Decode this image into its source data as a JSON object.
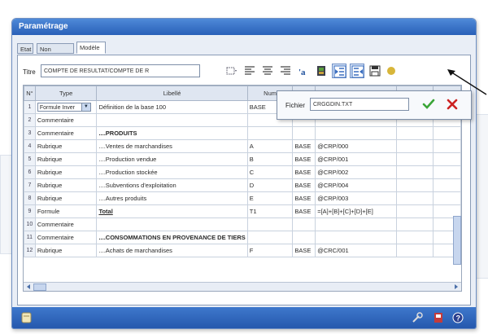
{
  "window": {
    "title": "Paramétrage"
  },
  "tabs": [
    {
      "label": "Etat",
      "active": false
    },
    {
      "label": "Non affectés",
      "active": false
    },
    {
      "label": "Modèle",
      "active": true
    }
  ],
  "toolbar": {
    "titre_label": "Titre",
    "titre_value": "COMPTE DE RESULTAT/COMPTE DE R",
    "icons": [
      "grid-menu-icon",
      "align-left-icon",
      "align-center-icon",
      "align-right-icon",
      "font-size-icon",
      "color-book-icon",
      "indent-in-icon",
      "indent-out-icon",
      "save-icon",
      "apply-icon"
    ]
  },
  "grid": {
    "columns": [
      "N°",
      "Type",
      "Libellé",
      "Num",
      "",
      "",
      ""
    ],
    "rows": [
      {
        "n": "1",
        "type": "Formule Inver",
        "combo": true,
        "libelle": "Définition de la base 100",
        "style": "",
        "num": "BASE",
        "base": "",
        "formula": ""
      },
      {
        "n": "2",
        "type": "Commentaire",
        "combo": false,
        "libelle": "",
        "style": "",
        "num": "",
        "base": "",
        "formula": ""
      },
      {
        "n": "3",
        "type": "Commentaire",
        "combo": false,
        "libelle": "....PRODUITS",
        "style": "bold",
        "num": "",
        "base": "",
        "formula": ""
      },
      {
        "n": "4",
        "type": "Rubrique",
        "combo": false,
        "libelle": "....Ventes de marchandises",
        "style": "",
        "num": "A",
        "base": "BASE",
        "formula": "@CRP/000"
      },
      {
        "n": "5",
        "type": "Rubrique",
        "combo": false,
        "libelle": "....Production vendue",
        "style": "",
        "num": "B",
        "base": "BASE",
        "formula": "@CRP/001"
      },
      {
        "n": "6",
        "type": "Rubrique",
        "combo": false,
        "libelle": "....Production stockée",
        "style": "",
        "num": "C",
        "base": "BASE",
        "formula": "@CRP/002"
      },
      {
        "n": "7",
        "type": "Rubrique",
        "combo": false,
        "libelle": "....Subventions d'exploitation",
        "style": "",
        "num": "D",
        "base": "BASE",
        "formula": "@CRP/004"
      },
      {
        "n": "8",
        "type": "Rubrique",
        "combo": false,
        "libelle": "....Autres produits",
        "style": "",
        "num": "E",
        "base": "BASE",
        "formula": "@CRP/003"
      },
      {
        "n": "9",
        "type": "Formule",
        "combo": false,
        "libelle": "Total",
        "style": "ul",
        "num": "T1",
        "base": "BASE",
        "formula": "=[A]+[B]+[C]+[D]+[E]"
      },
      {
        "n": "10",
        "type": "Commentaire",
        "combo": false,
        "libelle": "",
        "style": "",
        "num": "",
        "base": "",
        "formula": ""
      },
      {
        "n": "11",
        "type": "Commentaire",
        "combo": false,
        "libelle": "....CONSOMMATIONS EN PROVENANCE DE TIERS",
        "style": "bold",
        "num": "",
        "base": "",
        "formula": ""
      },
      {
        "n": "12",
        "type": "Rubrique",
        "combo": false,
        "libelle": "....Achats de marchandises",
        "style": "",
        "num": "F",
        "base": "BASE",
        "formula": "@CRC/001"
      }
    ]
  },
  "popup": {
    "label": "Fichier",
    "value": "CRGGDIN.TXT"
  },
  "colors": {
    "title_bar": "#2960b8",
    "window_bg": "#e9eef6",
    "status_bar": "#2558ad",
    "ok": "#3aa537",
    "cancel": "#cc2222"
  }
}
